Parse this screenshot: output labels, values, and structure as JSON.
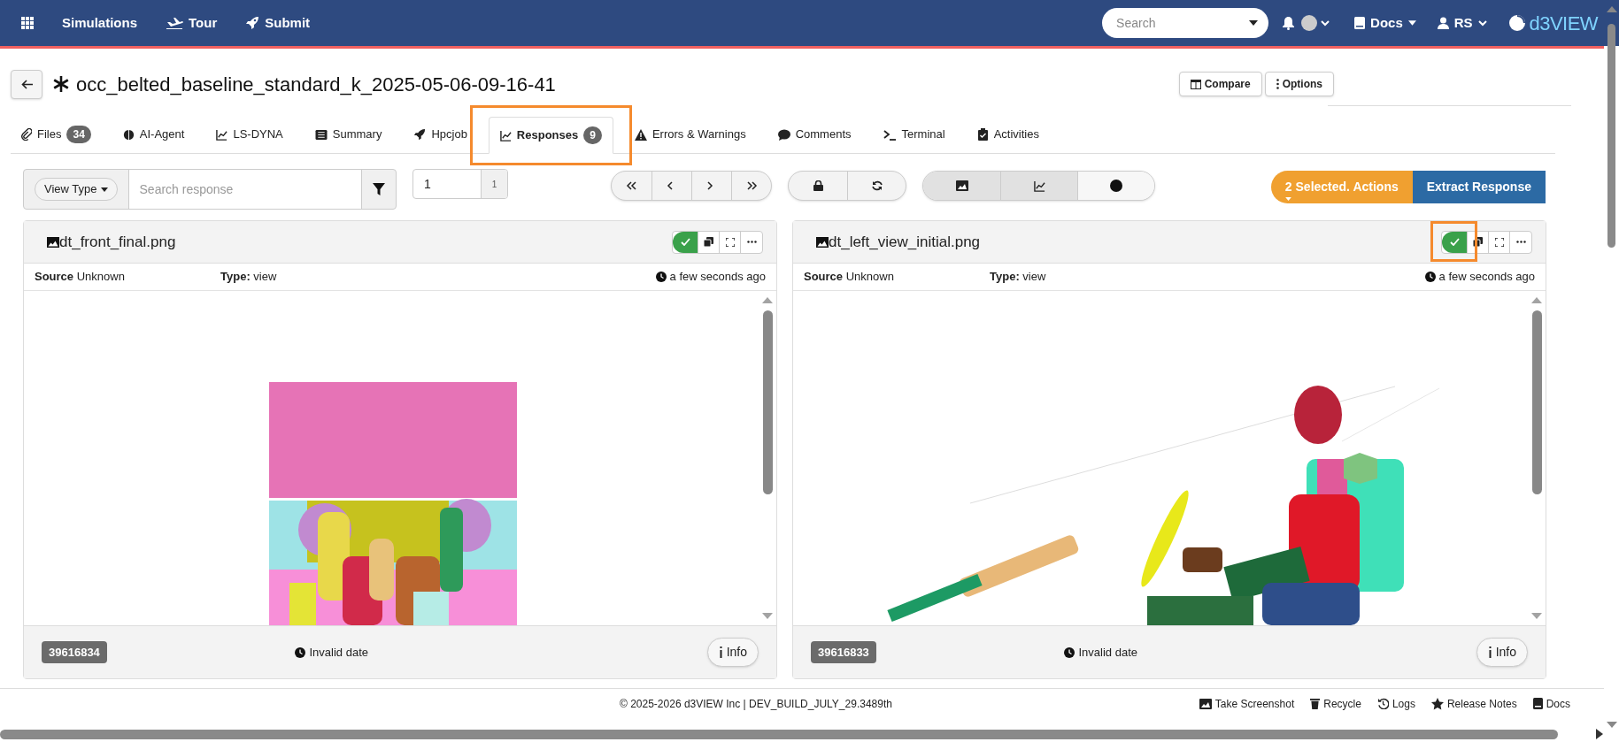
{
  "navbar": {
    "links": [
      "Simulations",
      "Tour",
      "Submit"
    ],
    "search": {
      "placeholder": "Search"
    },
    "docs": "Docs",
    "user": "RS",
    "logo": "d3VIEW"
  },
  "header": {
    "title": "occ_belted_baseline_standard_k_2025-05-06-09-16-41",
    "buttons": [
      "Compare",
      "Options"
    ]
  },
  "tabs": [
    {
      "label": "Files",
      "count": "34",
      "selected": false
    },
    {
      "label": "AI-Agent",
      "selected": false
    },
    {
      "label": "LS-DYNA",
      "selected": false
    },
    {
      "label": "Summary",
      "selected": false
    },
    {
      "label": "Hpcjob",
      "selected": false
    },
    {
      "label": "Responses",
      "count": "9",
      "selected": true
    },
    {
      "label": "Errors & Warnings",
      "selected": false
    },
    {
      "label": "Comments",
      "selected": false
    },
    {
      "label": "Terminal",
      "selected": false
    },
    {
      "label": "Activities",
      "selected": false
    }
  ],
  "toolbar": {
    "view_type": "View Type",
    "search": {
      "placeholder": "Search response"
    },
    "page": {
      "value": "1",
      "total": "1"
    },
    "view_modes": [
      {
        "selected": true
      },
      {
        "selected": true
      },
      {
        "selected": false
      }
    ],
    "actions": "2 Selected. Actions",
    "extract": "Extract Response"
  },
  "cards": [
    {
      "title": "dt_front_final.png",
      "selected": true,
      "source_label": "Source",
      "source": "Unknown",
      "type_label": "Type:",
      "type": "view",
      "time": "a few seconds ago",
      "id": "39616834",
      "date": "Invalid date",
      "info": "Info",
      "kind": "front"
    },
    {
      "title": "dt_left_view_initial.png",
      "selected": true,
      "source_label": "Source",
      "source": "Unknown",
      "type_label": "Type:",
      "type": "view",
      "time": "a few seconds ago",
      "id": "39616833",
      "date": "Invalid date",
      "info": "Info",
      "kind": "side"
    }
  ],
  "footer": {
    "copyright": "© 2025-2026 d3VIEW Inc | DEV_BUILD_JULY_29.3489th",
    "links": [
      "Take Screenshot",
      "Recycle",
      "Logs",
      "Release Notes",
      "Docs"
    ]
  }
}
